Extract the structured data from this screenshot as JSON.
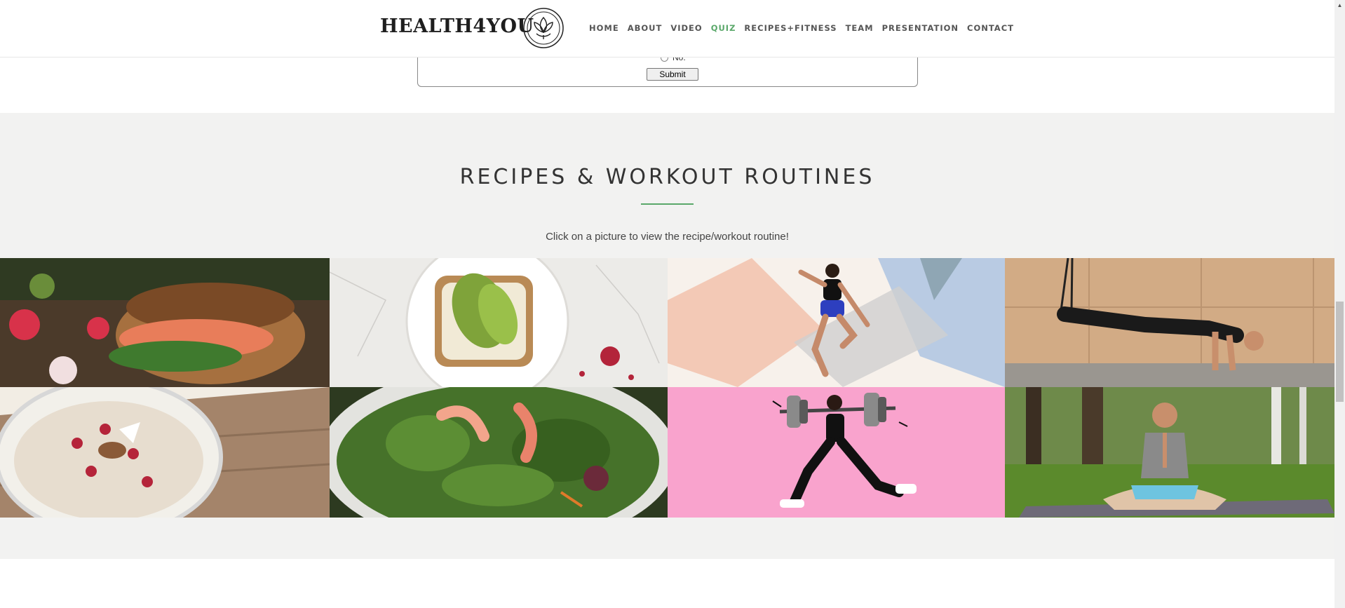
{
  "header": {
    "logo_text": "HEALTH4YOU",
    "nav": [
      {
        "label": "HOME",
        "active": false
      },
      {
        "label": "ABOUT",
        "active": false
      },
      {
        "label": "VIDEO",
        "active": false
      },
      {
        "label": "QUIZ",
        "active": true
      },
      {
        "label": "RECIPES+FITNESS",
        "active": false
      },
      {
        "label": "TEAM",
        "active": false
      },
      {
        "label": "PRESENTATION",
        "active": false
      },
      {
        "label": "CONTACT",
        "active": false
      }
    ]
  },
  "quiz": {
    "option_label": "No.",
    "submit_label": "Submit"
  },
  "recipes": {
    "title": "RECIPES & WORKOUT ROUTINES",
    "subtitle": "Click on a picture to view the recipe/workout routine!",
    "tiles": [
      {
        "name": "salmon-bagel"
      },
      {
        "name": "avocado-toast"
      },
      {
        "name": "jumping-workout"
      },
      {
        "name": "trx-workout"
      },
      {
        "name": "pomegranate-oats"
      },
      {
        "name": "kale-salad"
      },
      {
        "name": "barbell-lunge"
      },
      {
        "name": "meditation"
      }
    ]
  },
  "colors": {
    "accent": "#5aa86a",
    "section_bg": "#f2f2f1",
    "text_dark": "#333333"
  }
}
